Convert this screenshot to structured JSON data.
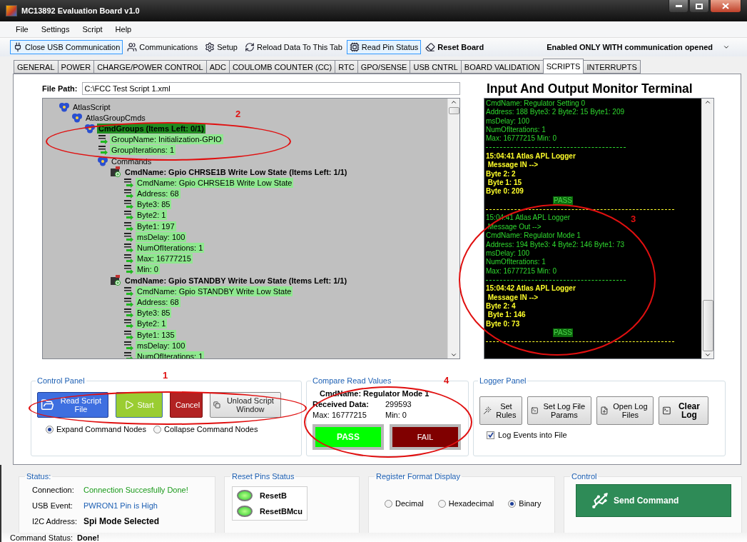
{
  "window": {
    "title": "MC13892 Evaluation Board v1.0"
  },
  "menu": [
    "File",
    "Settings",
    "Script",
    "Help"
  ],
  "toolbar": [
    {
      "label": "Close USB Communication",
      "checked": true
    },
    {
      "label": "Communications",
      "checked": false
    },
    {
      "label": "Setup",
      "checked": false
    },
    {
      "label": "Reload Data To This Tab",
      "checked": false
    },
    {
      "label": "Read Pin Status",
      "checked": true
    },
    {
      "label": "Reset Board",
      "checked": false
    }
  ],
  "mode_dropdown": {
    "value": "Enabled  ONLY WITH communication opened"
  },
  "tabs": [
    {
      "label": "GENERAL",
      "selected": false
    },
    {
      "label": "POWER",
      "selected": false
    },
    {
      "label": "CHARGE/POWER CONTROL",
      "selected": false
    },
    {
      "label": "ADC",
      "selected": false
    },
    {
      "label": "COULOMB COUNTER (CC)",
      "selected": false
    },
    {
      "label": "RTC",
      "selected": false
    },
    {
      "label": "GPO/SENSE",
      "selected": false
    },
    {
      "label": "USB CNTRL",
      "selected": false
    },
    {
      "label": "BOARD VALIDATION",
      "selected": false
    },
    {
      "label": "SCRIPTS",
      "selected": true
    },
    {
      "label": "INTERRUPTS",
      "selected": false
    }
  ],
  "file_path": {
    "label": "File Path:",
    "value": "C:\\FCC Test Script 1.xml"
  },
  "tree": [
    {
      "label": "AtlasScript",
      "kind": "group",
      "selected": false,
      "children": [
        {
          "label": "AtlasGroupCmds",
          "kind": "group",
          "selected": false,
          "children": [
            {
              "label": "CmdGroups  (Items Left: 0/1)",
              "kind": "group",
              "selected": true,
              "children": [
                {
                  "label": "GroupName: Initialization-GPIO",
                  "kind": "field",
                  "selected": false
                },
                {
                  "label": "GroupIterations: 1",
                  "kind": "field",
                  "selected": false
                },
                {
                  "label": "Commands",
                  "kind": "group",
                  "selected": false,
                  "children": [
                    {
                      "label": "CmdName: Gpio CHRSE1B Write Low State  (Items Left: 1/1)",
                      "kind": "command",
                      "selected": false,
                      "children": [
                        {
                          "label": "CmdName: Gpio CHRSE1B Write Low State",
                          "kind": "field",
                          "selected": false
                        },
                        {
                          "label": "Address: 68",
                          "kind": "field",
                          "selected": false
                        },
                        {
                          "label": "Byte3: 85",
                          "kind": "field",
                          "selected": false
                        },
                        {
                          "label": "Byte2: 1",
                          "kind": "field",
                          "selected": false
                        },
                        {
                          "label": "Byte1: 197",
                          "kind": "field",
                          "selected": false
                        },
                        {
                          "label": "msDelay: 100",
                          "kind": "field",
                          "selected": false
                        },
                        {
                          "label": "NumOfIterations: 1",
                          "kind": "field",
                          "selected": false
                        },
                        {
                          "label": "Max: 16777215",
                          "kind": "field",
                          "selected": false
                        },
                        {
                          "label": "Min: 0",
                          "kind": "field",
                          "selected": false
                        }
                      ]
                    },
                    {
                      "label": "CmdName: Gpio STANDBY Write Low State  (Items Left: 1/1)",
                      "kind": "command",
                      "selected": false,
                      "children": [
                        {
                          "label": "CmdName: Gpio STANDBY Write Low State",
                          "kind": "field",
                          "selected": false
                        },
                        {
                          "label": "Address: 68",
                          "kind": "field",
                          "selected": false
                        },
                        {
                          "label": "Byte3: 85",
                          "kind": "field",
                          "selected": false
                        },
                        {
                          "label": "Byte2: 1",
                          "kind": "field",
                          "selected": false
                        },
                        {
                          "label": "Byte1: 135",
                          "kind": "field",
                          "selected": false
                        },
                        {
                          "label": "msDelay: 100",
                          "kind": "field",
                          "selected": false
                        },
                        {
                          "label": "NumOfIterations: 1",
                          "kind": "field",
                          "selected": false
                        }
                      ]
                    }
                  ]
                }
              ]
            }
          ]
        }
      ]
    }
  ],
  "terminal": {
    "title": "Input And Output Monitor Terminal",
    "lines": [
      {
        "kind": "out",
        "text": "CmdName: Regulator Setting 0"
      },
      {
        "kind": "out",
        "text": "Address: 188 Byte3: 2 Byte2: 15 Byte1: 209"
      },
      {
        "kind": "out",
        "text": "msDelay: 100"
      },
      {
        "kind": "out",
        "text": "NumOfIterations: 1"
      },
      {
        "kind": "out",
        "text": "Max: 16777215 Min: 0"
      },
      {
        "kind": "sep-out"
      },
      {
        "kind": "in",
        "text": "15:04:41 Atlas APL Logger"
      },
      {
        "kind": "in",
        "text": " Message IN -->"
      },
      {
        "kind": "in",
        "text": "Byte 2: 2"
      },
      {
        "kind": "in",
        "text": " Byte 1: 15"
      },
      {
        "kind": "in",
        "text": "Byte 0: 209"
      },
      {
        "kind": "pass",
        "text": "PASS"
      },
      {
        "kind": "sep-in"
      },
      {
        "kind": "out",
        "text": "15:04:41 Atlas APL Logger"
      },
      {
        "kind": "out",
        "text": " Message Out -->"
      },
      {
        "kind": "out",
        "text": "CmdName: Regulator Mode 1"
      },
      {
        "kind": "out",
        "text": "Address: 194 Byte3: 4 Byte2: 146 Byte1: 73"
      },
      {
        "kind": "out",
        "text": "msDelay: 100"
      },
      {
        "kind": "out",
        "text": "NumOfIterations: 1"
      },
      {
        "kind": "out",
        "text": "Max: 16777215 Min: 0"
      },
      {
        "kind": "sep-out"
      },
      {
        "kind": "in",
        "text": "15:04:42 Atlas APL Logger"
      },
      {
        "kind": "in",
        "text": " Message IN -->"
      },
      {
        "kind": "in",
        "text": "Byte 2: 4"
      },
      {
        "kind": "in",
        "text": " Byte 1: 146"
      },
      {
        "kind": "in",
        "text": "Byte 0: 73"
      },
      {
        "kind": "pass",
        "text": "PASS"
      },
      {
        "kind": "sep-in"
      }
    ]
  },
  "control_panel": {
    "title": "Control Panel",
    "buttons": [
      {
        "label": "Read Script File",
        "kind": "blue"
      },
      {
        "label": "Start",
        "kind": "green"
      },
      {
        "label": "Cancel",
        "kind": "red"
      },
      {
        "label": "Unload Script Window",
        "kind": "gray"
      }
    ],
    "options": [
      {
        "label": "Expand Command Nodes",
        "selected": true
      },
      {
        "label": "Collapse Command Nodes",
        "selected": false
      }
    ]
  },
  "compare_panel": {
    "title": "Compare Read Values",
    "cmd_name": "CmdName: Regulator Mode 1",
    "received_label": "Received Data:",
    "received_value": "299593",
    "max": "Max: 16777215",
    "min": "Min: 0",
    "results": [
      {
        "label": "PASS",
        "kind": "pass"
      },
      {
        "label": "FAIL",
        "kind": "fail"
      }
    ]
  },
  "logger_panel": {
    "title": "Logger Panel",
    "buttons": [
      {
        "label": "Set Rules",
        "bold": false
      },
      {
        "label": "Set Log File Params",
        "bold": false
      },
      {
        "label": "Open Log Files",
        "bold": false
      },
      {
        "label": "Clear Log",
        "bold": true
      }
    ],
    "log_to_file": {
      "label": "Log Events into File",
      "checked": true
    }
  },
  "status_panel": {
    "title": "Status:",
    "rows": [
      {
        "label": "Connection:",
        "value": "Connection Succesfully Done!",
        "kind": "ok"
      },
      {
        "label": "USB Event:",
        "value": "PWRON1 Pin is High",
        "kind": "info"
      },
      {
        "label": "I2C Address:",
        "value": "Spi Mode Selected",
        "kind": "bold"
      }
    ]
  },
  "reset_pins": {
    "title": "Reset Pins Status",
    "pins": [
      {
        "label": "ResetB",
        "on": true
      },
      {
        "label": "ResetBMcu",
        "on": true
      }
    ]
  },
  "register_format": {
    "title": "Register Format Display",
    "options": [
      {
        "label": "Decimal",
        "selected": false
      },
      {
        "label": "Hexadecimal",
        "selected": false
      },
      {
        "label": "Binary",
        "selected": true
      }
    ]
  },
  "control": {
    "title": "Control",
    "button": "Send Command"
  },
  "status_bar": {
    "label": "Command Status:",
    "value": "Done!"
  },
  "annotations": [
    "1",
    "2",
    "3",
    "4"
  ]
}
